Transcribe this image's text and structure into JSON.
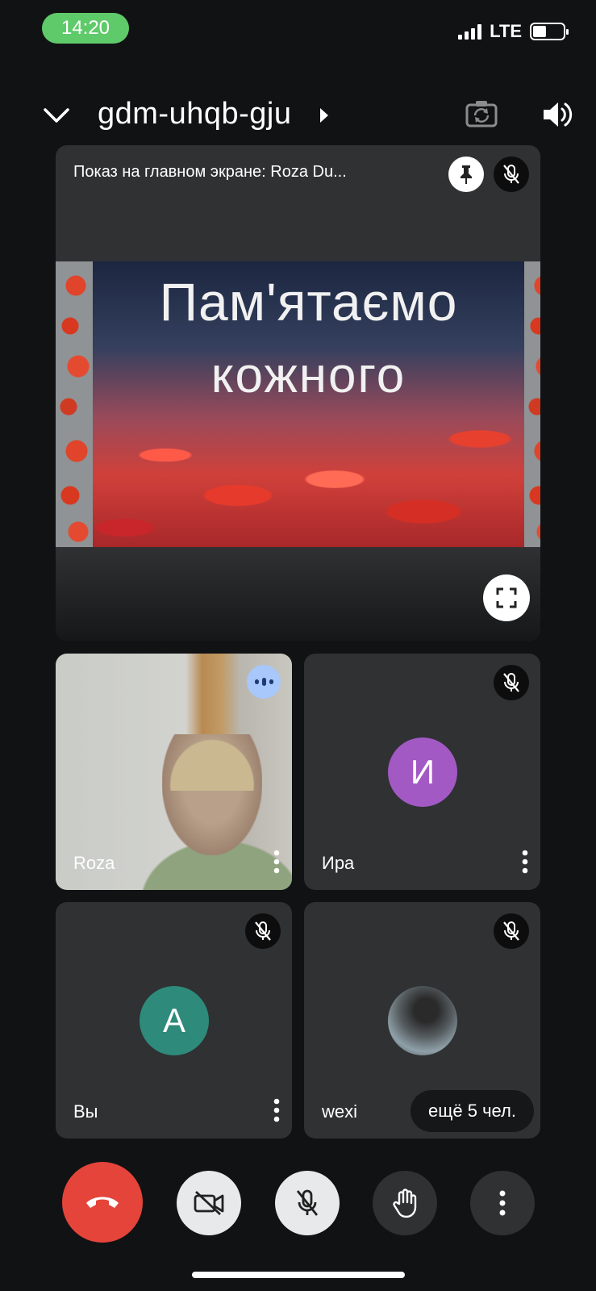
{
  "status_bar": {
    "time": "14:20",
    "network": "LTE",
    "signal_bars": 4,
    "battery_level": 0.45
  },
  "header": {
    "meeting_code": "gdm-uhqb-gju",
    "icons": [
      "chevron-down-icon",
      "play-arrow-icon",
      "camera-switch-icon",
      "speaker-icon"
    ]
  },
  "presentation": {
    "title": "Показ на главном экране: Roza Du...",
    "slide_line1": "Пам'ятаємо",
    "slide_line2": "кожного",
    "icons": [
      "pin-icon",
      "mic-off-icon",
      "fullscreen-icon"
    ]
  },
  "participants": [
    {
      "name": "Roza",
      "kind": "video",
      "status_icon": "speaking-icon"
    },
    {
      "name": "Ира",
      "kind": "avatar",
      "initial": "И",
      "avatar_color": "#a259c4",
      "status_icon": "mic-off-icon"
    },
    {
      "name": "Вы",
      "kind": "avatar",
      "initial": "A",
      "avatar_color": "#2e8a7a",
      "status_icon": "mic-off-icon"
    },
    {
      "name": "wexi",
      "kind": "photo",
      "status_icon": "mic-off-icon"
    }
  ],
  "more_participants_label": "ещё 5 чел.",
  "controls": [
    {
      "name": "end-call",
      "icon": "phone-hangup-icon",
      "color": "#e5443a"
    },
    {
      "name": "camera",
      "icon": "camera-off-icon",
      "color": "#e8e9ea"
    },
    {
      "name": "microphone",
      "icon": "mic-off-icon",
      "color": "#e8e9ea"
    },
    {
      "name": "raise-hand",
      "icon": "hand-icon",
      "color": "#2f3133"
    },
    {
      "name": "more-options",
      "icon": "more-vertical-icon",
      "color": "#2f3133"
    }
  ],
  "colors": {
    "background": "#111214",
    "tile": "#2f3133",
    "status_time_pill": "#5fca6a",
    "speaking_badge": "#a8c7fa"
  }
}
